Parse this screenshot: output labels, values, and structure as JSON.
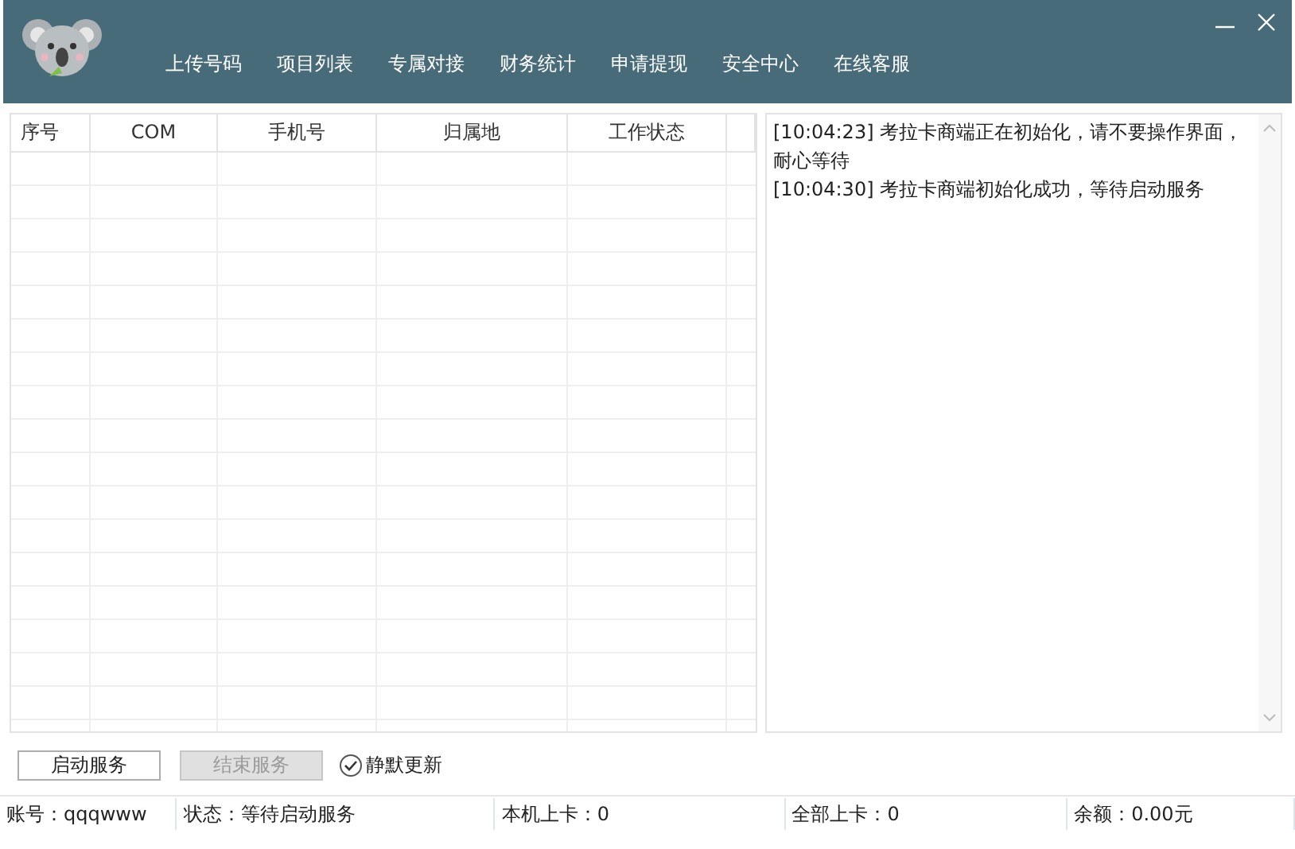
{
  "nav": [
    {
      "label": "上传号码"
    },
    {
      "label": "项目列表"
    },
    {
      "label": "专属对接"
    },
    {
      "label": "财务统计"
    },
    {
      "label": "申请提现"
    },
    {
      "label": "安全中心"
    },
    {
      "label": "在线客服"
    }
  ],
  "table": {
    "columns": [
      "序号",
      "COM",
      "手机号",
      "归属地",
      "工作状态"
    ]
  },
  "log": [
    "[10:04:23] 考拉卡商端正在初始化，请不要操作界面，耐心等待",
    "[10:04:30] 考拉卡商端初始化成功，等待启动服务"
  ],
  "buttons": [
    {
      "label": "启动服务",
      "disabled": false
    },
    {
      "label": "结束服务",
      "disabled": true
    }
  ],
  "silent_update": {
    "label": "静默更新",
    "checked": true
  },
  "status_bar": [
    "账号：qqqwww",
    "状态：等待启动服务",
    "本机上卡：0",
    "全部上卡：0",
    "余额：0.00元"
  ]
}
